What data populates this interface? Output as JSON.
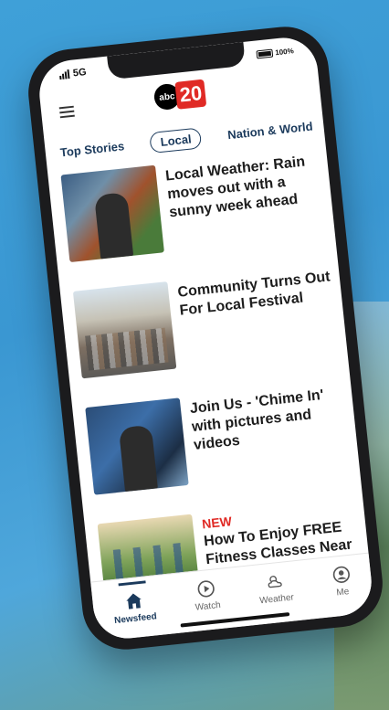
{
  "status": {
    "network": "5G",
    "battery": "100%"
  },
  "logo": {
    "abc": "abc",
    "channel": "20"
  },
  "tabs": [
    {
      "label": "Top Stories"
    },
    {
      "label": "Local"
    },
    {
      "label": "Nation & World"
    }
  ],
  "stories": [
    {
      "badge": "",
      "title": "Local Weather: Rain moves out with a sunny week ahead"
    },
    {
      "badge": "",
      "title": "Community Turns Out For Local Festival"
    },
    {
      "badge": "",
      "title": "Join Us - 'Chime In' with pictures and videos"
    },
    {
      "badge": "NEW",
      "title": "How To Enjoy FREE Fitness Classes Near You"
    }
  ],
  "nav": [
    {
      "label": "Newsfeed",
      "icon": "home-icon"
    },
    {
      "label": "Watch",
      "icon": "play-icon"
    },
    {
      "label": "Weather",
      "icon": "weather-icon"
    },
    {
      "label": "Me",
      "icon": "profile-icon"
    }
  ]
}
